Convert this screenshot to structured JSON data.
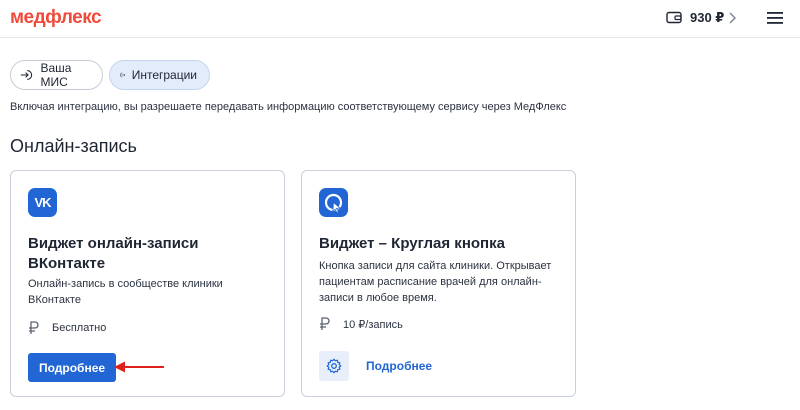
{
  "header": {
    "logo": "медфлекс",
    "balance": "930 ₽",
    "wallet_icon": "wallet-icon",
    "menu_icon": "hamburger-menu-icon"
  },
  "tabs": [
    {
      "label": "Ваша МИС",
      "icon": "login-arrow-icon",
      "active": false
    },
    {
      "label": "Интеграции",
      "icon": "logout-arrow-icon",
      "active": true
    }
  ],
  "info_text": "Включая интеграцию, вы разрешаете передавать информацию соответствующему сервису через МедФлекс",
  "section_title": "Онлайн-запись",
  "cards": [
    {
      "logo_text": "VK",
      "logo_icon": "vk-logo-icon",
      "title": "Виджет онлайн-записи ВКонтакте",
      "description": "Онлайн-запись в сообществе клиники ВКонтакте",
      "price": "Бесплатно",
      "button_label": "Подробнее"
    },
    {
      "logo_icon": "round-button-logo-icon",
      "title": "Виджет – Круглая кнопка",
      "description": "Кнопка записи для сайта клиники. Открывает пациентам расписание врачей для онлайн-записи в любое время.",
      "price": "10 ₽/запись",
      "settings_icon": "gear-icon",
      "link_label": "Подробнее"
    }
  ],
  "colors": {
    "brand": "#ef4a3c",
    "accent": "#2166d4",
    "annotation_arrow": "#e0211b"
  }
}
